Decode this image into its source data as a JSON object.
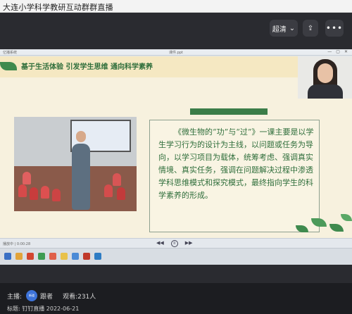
{
  "window": {
    "title": "大连小学科学教研互动群群直播"
  },
  "player_controls": {
    "quality_label": "超清",
    "quality_caret": "⌄",
    "share_icon": "⇪",
    "more_icon": "•••"
  },
  "screen": {
    "top_bar_left": "亿播系统",
    "top_bar_mid": "课件.ppt",
    "win_min": "—",
    "win_max": "▢",
    "win_close": "✕"
  },
  "slide": {
    "banner_text": "基于生活体验 引发学生思维 通向科学素养",
    "body_text": "《微生物的“功”与“过”》一课主要是以学生学习行为的设计为主线，以问题或任务为导向，以学习项目为载体，统筹考虑、强调真实情境、真实任务，强调在问题解决过程中渗透学科思维模式和探究模式，最终指向学生的科学素养的形成。"
  },
  "playbar": {
    "left_text": "播放中 | 0:00:28",
    "prev": "◀◀",
    "play": "II",
    "next": "▶▶"
  },
  "footer": {
    "host_label": "主播:",
    "host_avatar": "新道",
    "host_name": "跟者",
    "viewers_label": "观看:",
    "viewers_count": "231人",
    "title_label": "标题:",
    "title_value": "钉钉直播 2022-06-21"
  },
  "colors": {
    "slide_green": "#2f6e3b",
    "slide_bg": "#f7f1de",
    "accent_blue": "#3d73d9"
  }
}
